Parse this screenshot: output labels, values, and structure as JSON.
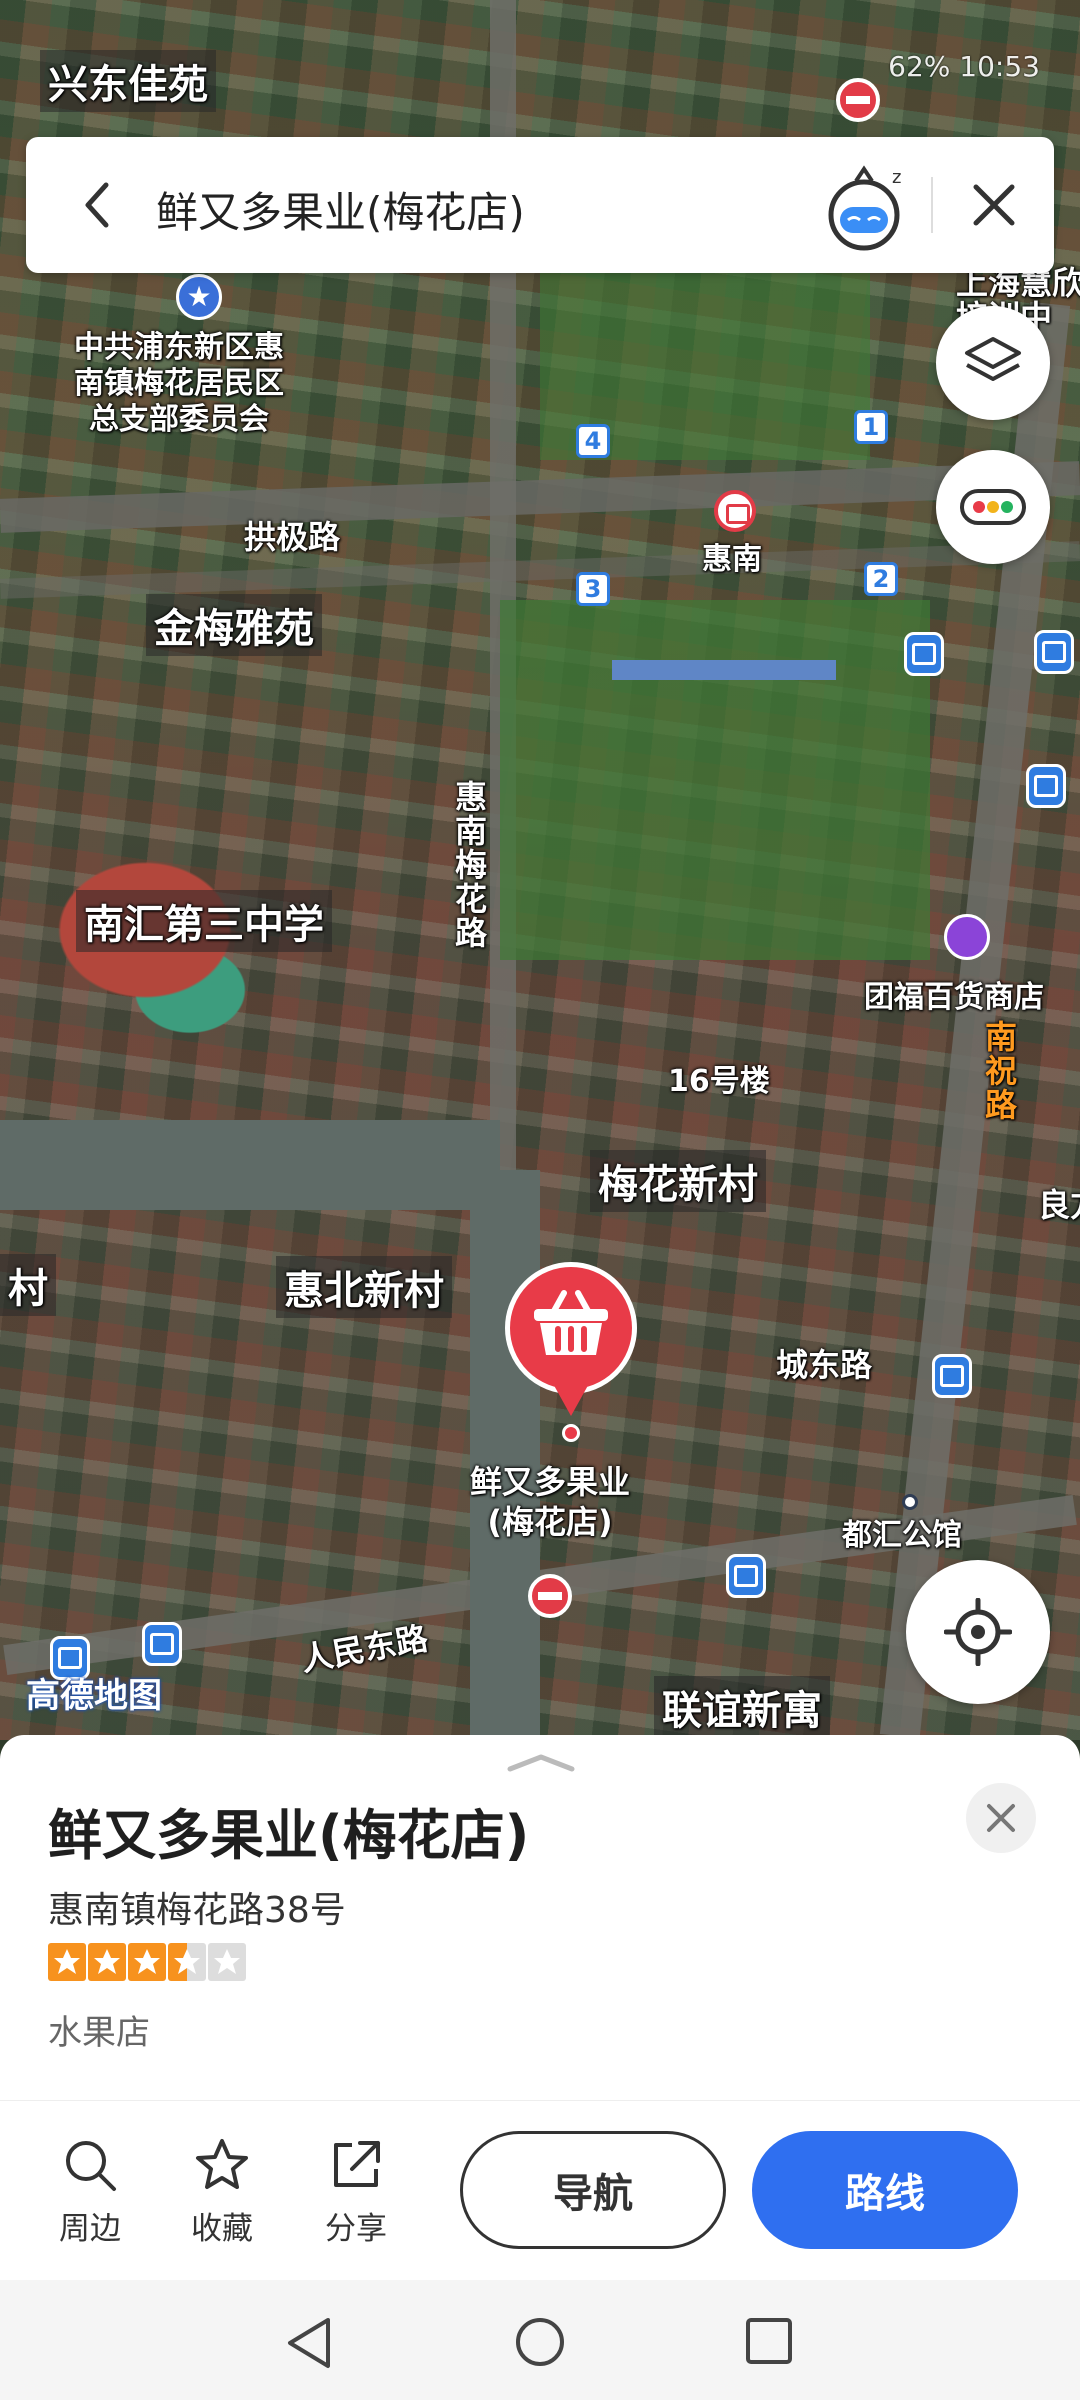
{
  "status_bar": {
    "text": "62% 10:53"
  },
  "search": {
    "query": "鲜又多果业(梅花店)"
  },
  "map": {
    "labels": {
      "xingdong": "兴东佳苑",
      "party": "中共浦东新区惠\n南镇梅花居民区\n总支部委员会",
      "shanghai": "上海慧欣\n培训中",
      "gongji": "拱极路",
      "huinan": "惠南",
      "jinmei": "金梅雅苑",
      "huinan_meihua": "惠南梅花路",
      "nanhui3": "南汇第三中学",
      "tuanfu": "团福百货商店",
      "nanzhu": "南祝路",
      "bldg16": "16号楼",
      "meihua_village": "梅花新村",
      "liang": "良方",
      "cun": "村",
      "huibei": "惠北新村",
      "chengdong": "城东路",
      "pin_label": "鲜又多果业\n(梅花店)",
      "duhui": "都汇公馆",
      "renmin": "人民东路",
      "lianyi": "联谊新寓",
      "amap": "高德地图"
    },
    "exits": [
      "4",
      "3",
      "1",
      "2"
    ]
  },
  "place": {
    "name": "鲜又多果业(梅花店)",
    "address": "惠南镇梅花路38号",
    "rating": 3.5,
    "category": "水果店"
  },
  "actions": {
    "nearby": "周边",
    "favorite": "收藏",
    "share": "分享",
    "navigate": "导航",
    "route": "路线"
  },
  "colors": {
    "accent": "#2f6ff0",
    "pin": "#e83b48",
    "star": "#f7921e"
  }
}
